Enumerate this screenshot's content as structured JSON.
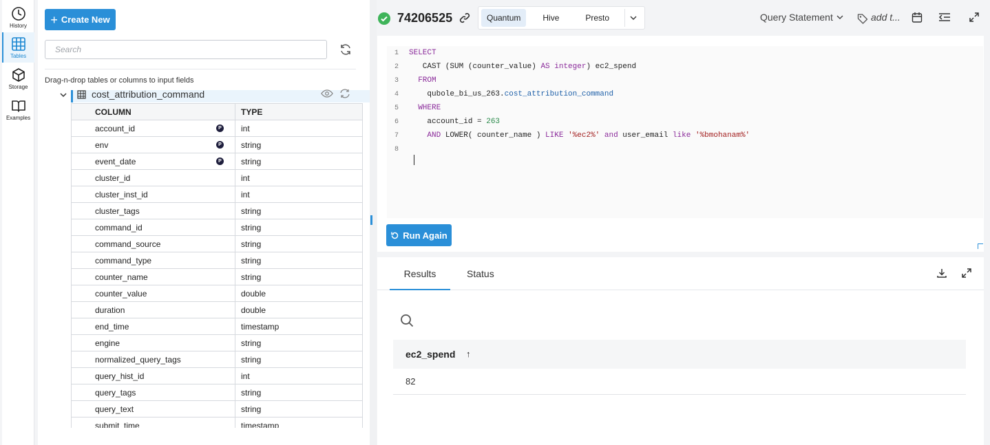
{
  "rail": {
    "items": [
      {
        "label": "History",
        "icon": "clock-icon"
      },
      {
        "label": "Tables",
        "icon": "grid-icon"
      },
      {
        "label": "Storage",
        "icon": "cube-icon"
      },
      {
        "label": "Examples",
        "icon": "book-icon"
      }
    ],
    "active": "Tables"
  },
  "left": {
    "create_label": "Create New",
    "search_placeholder": "Search",
    "drag_hint": "Drag-n-drop tables or columns to input fields",
    "table_name": "cost_attribution_command",
    "headers": {
      "column": "COLUMN",
      "type": "TYPE"
    },
    "columns": [
      {
        "name": "account_id",
        "type": "int",
        "partition": true
      },
      {
        "name": "env",
        "type": "string",
        "partition": true
      },
      {
        "name": "event_date",
        "type": "string",
        "partition": true
      },
      {
        "name": "cluster_id",
        "type": "int"
      },
      {
        "name": "cluster_inst_id",
        "type": "int"
      },
      {
        "name": "cluster_tags",
        "type": "string"
      },
      {
        "name": "command_id",
        "type": "string"
      },
      {
        "name": "command_source",
        "type": "string"
      },
      {
        "name": "command_type",
        "type": "string"
      },
      {
        "name": "counter_name",
        "type": "string"
      },
      {
        "name": "counter_value",
        "type": "double"
      },
      {
        "name": "duration",
        "type": "double"
      },
      {
        "name": "end_time",
        "type": "timestamp"
      },
      {
        "name": "engine",
        "type": "string"
      },
      {
        "name": "normalized_query_tags",
        "type": "string"
      },
      {
        "name": "query_hist_id",
        "type": "int"
      },
      {
        "name": "query_tags",
        "type": "string"
      },
      {
        "name": "query_text",
        "type": "string"
      },
      {
        "name": "submit_time",
        "type": "timestamp"
      }
    ],
    "partition_badge": "P"
  },
  "topbar": {
    "query_id": "74206525",
    "engines": [
      "Quantum",
      "Hive",
      "Presto"
    ],
    "active_engine": "Quantum",
    "query_statement_label": "Query Statement",
    "add_tags_label": "add t..."
  },
  "editor": {
    "line_numbers": [
      "1",
      "2",
      "3",
      "4",
      "5",
      "6",
      "7",
      "8"
    ],
    "run_label": "Run Again"
  },
  "results": {
    "tabs": [
      "Results",
      "Status"
    ],
    "column": "ec2_spend",
    "sort_arrow": "↑",
    "value": "82"
  },
  "colors": {
    "accent": "#2a8fd8",
    "success": "#3fb45a"
  }
}
